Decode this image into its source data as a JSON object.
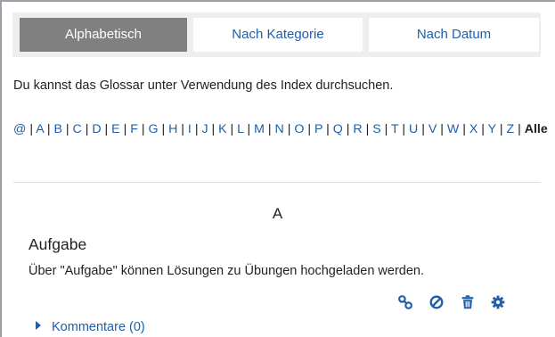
{
  "tabs": [
    {
      "label": "Alphabetisch",
      "active": true
    },
    {
      "label": "Nach Kategorie",
      "active": false
    },
    {
      "label": "Nach Datum",
      "active": false
    }
  ],
  "intro_text": "Du kannst das Glossar unter Verwendung des Index durchsuchen.",
  "index": {
    "letters": [
      "@",
      "A",
      "B",
      "C",
      "D",
      "E",
      "F",
      "G",
      "H",
      "I",
      "J",
      "K",
      "L",
      "M",
      "N",
      "O",
      "P",
      "Q",
      "R",
      "S",
      "T",
      "U",
      "V",
      "W",
      "X",
      "Y",
      "Z"
    ],
    "all_label": "Alle"
  },
  "section_letter": "A",
  "entry": {
    "title": "Aufgabe",
    "text": "Über \"Aufgabe\" können Lösungen zu Übungen hochgeladen werden."
  },
  "actions": [
    {
      "icon": "link-icon"
    },
    {
      "icon": "ban-icon"
    },
    {
      "icon": "trash-icon"
    },
    {
      "icon": "gear-icon"
    }
  ],
  "comments_label": "Kommentare (0)",
  "colors": {
    "link": "#1f5fa8",
    "active_tab": "#808080",
    "tab_bar": "#eeeeee"
  }
}
